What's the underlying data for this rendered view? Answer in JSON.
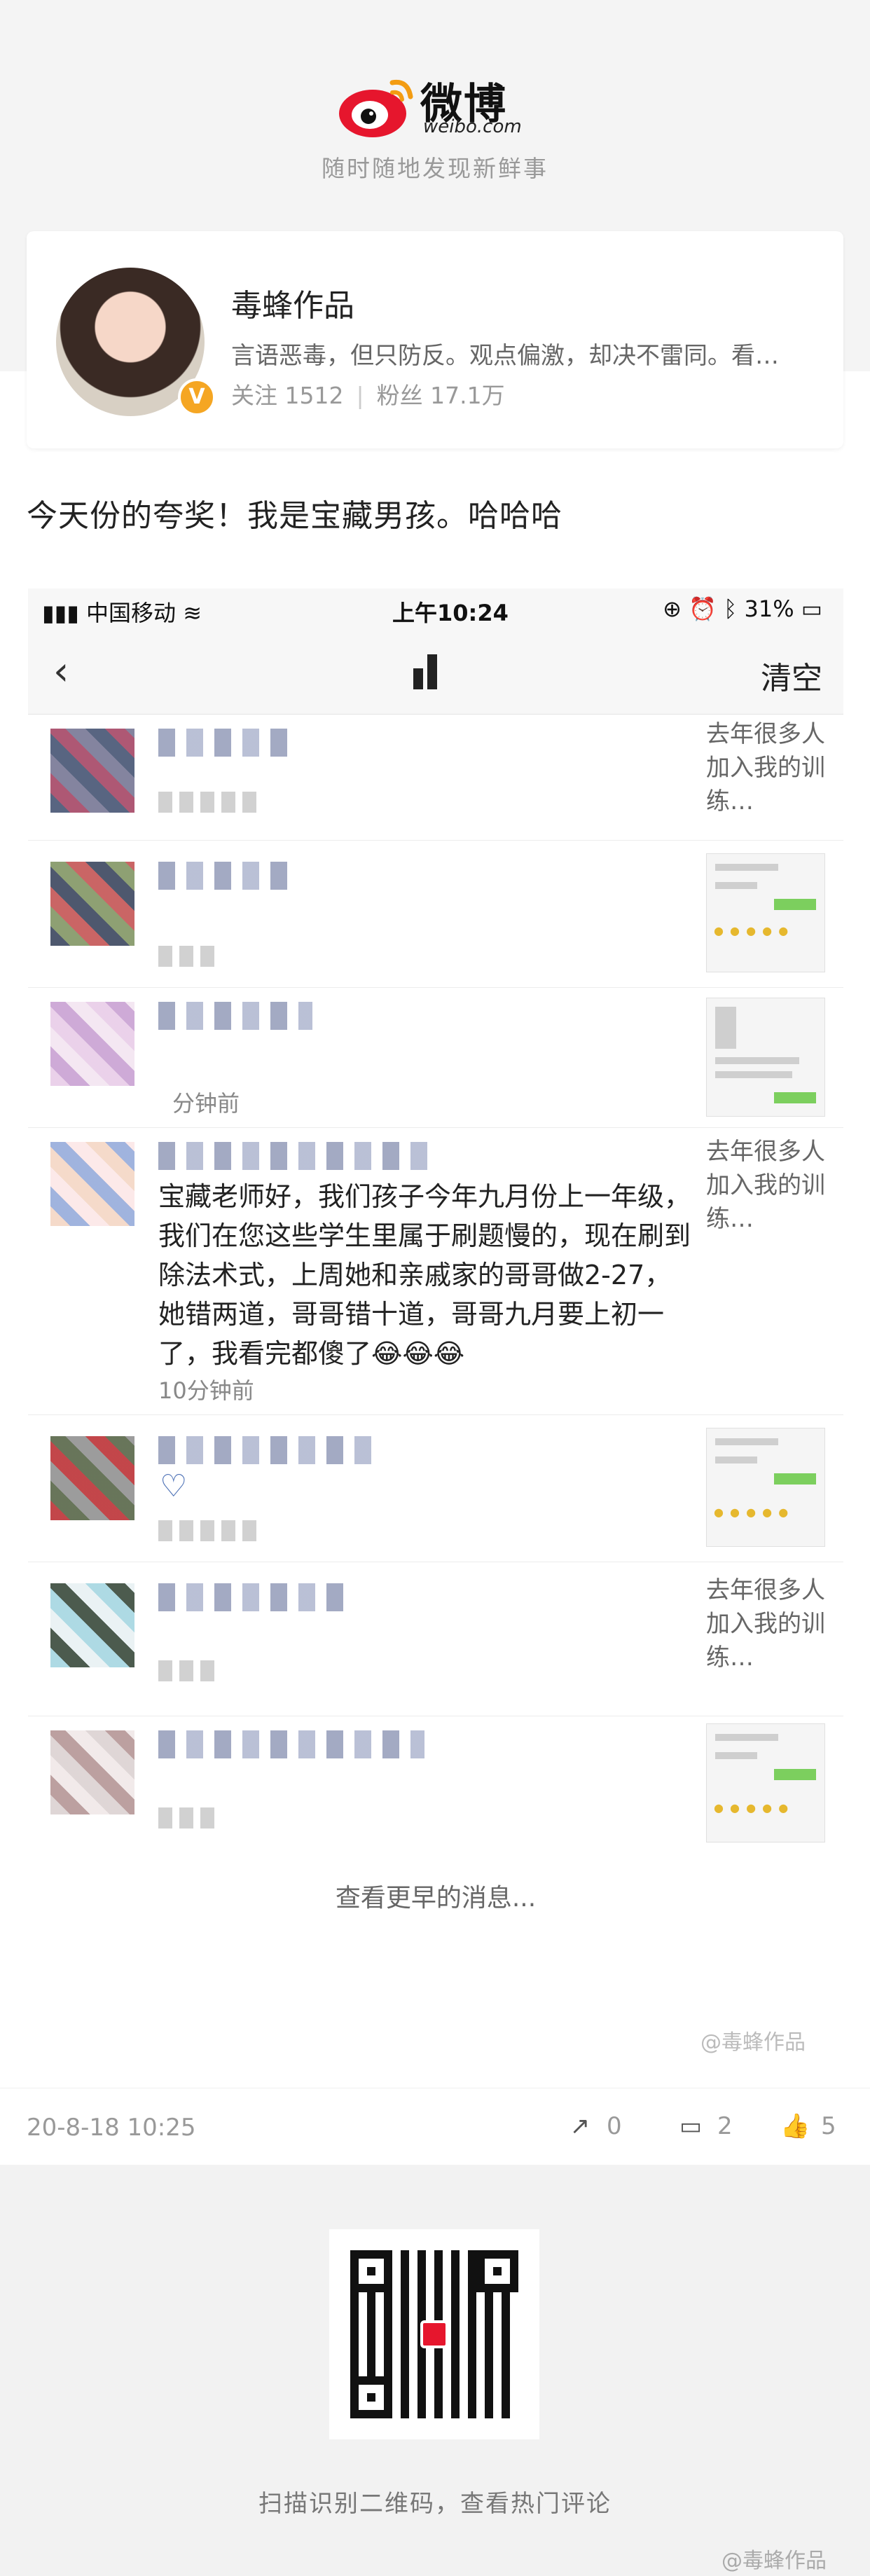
{
  "header": {
    "logo_text": "微博",
    "logo_sub": "weibo.com",
    "tagline": "随时随地发现新鲜事"
  },
  "profile": {
    "name": "毒蜂作品",
    "bio": "言语恶毒，但只防反。观点偏激，却决不雷同。看…",
    "following_label": "关注 1512",
    "followers_label": "粉丝 17.1万",
    "verified_icon": "verified-badge-icon"
  },
  "post": {
    "text": "今天份的夸奖！我是宝藏男孩。哈哈哈",
    "date": "20-8-18 10:25",
    "share_count": "0",
    "comment_count": "2",
    "like_count": "5",
    "watermark": "@毒蜂作品"
  },
  "screenshot": {
    "status": {
      "carrier": "中国移动",
      "time": "上午10:24",
      "battery": "31%"
    },
    "nav": {
      "back": "‹",
      "clear": "清空"
    },
    "messages": [
      {
        "right_text": "去年很多人加入我的训练…"
      },
      {
        "right_text": ""
      },
      {
        "time": "分钟前"
      },
      {
        "content": "宝藏老师好，我们孩子今年九月份上一年级，我们在您这些学生里属于刷题慢的，现在刷到除法术式，上周她和亲戚家的哥哥做2-27，她错两道，哥哥错十道，哥哥九月要上初一了，我看完都傻了😂😂😂",
        "time": "10分钟前",
        "right_text": "去年很多人加入我的训练…"
      },
      {
        "right_text": ""
      },
      {
        "right_text": "去年很多人加入我的训练…"
      },
      {
        "right_text": ""
      }
    ],
    "see_earlier": "查看更早的消息..."
  },
  "bottom": {
    "qr_caption": "扫描识别二维码，查看热门评论",
    "watermark": "@毒蜂作品"
  }
}
